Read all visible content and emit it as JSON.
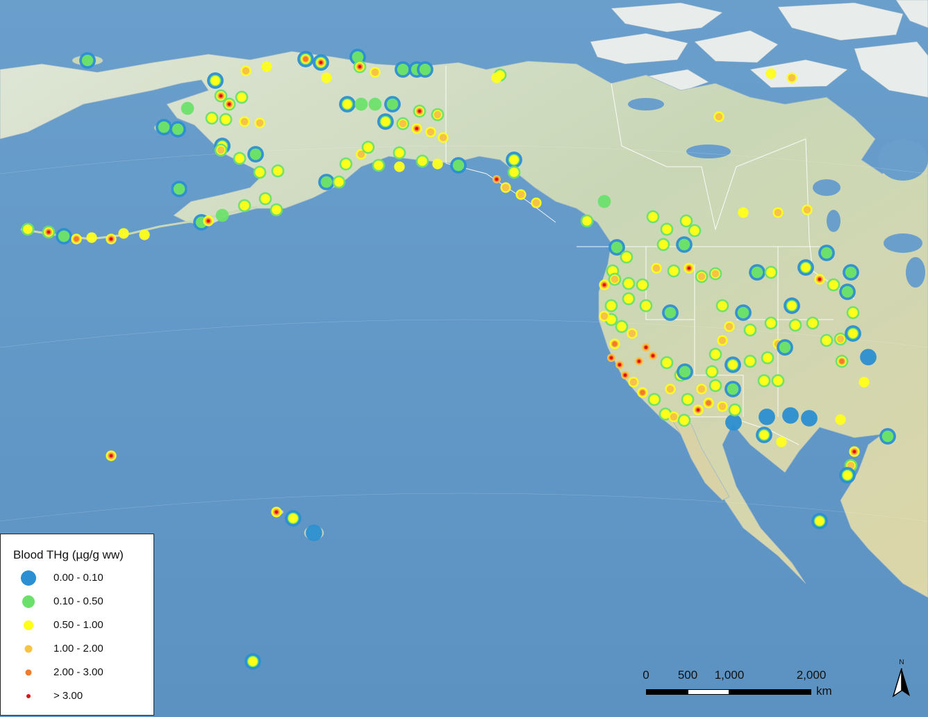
{
  "legend": {
    "title": "Blood THg (µg/g ww)",
    "classes": [
      {
        "label": "0.00 - 0.10",
        "color": "#2b8fd1",
        "glow": ""
      },
      {
        "label": "0.10 - 0.50",
        "color": "#6be06b",
        "glow": ""
      },
      {
        "label": "0.50 - 1.00",
        "color": "#ffff1c",
        "glow": ""
      },
      {
        "label": "1.00 - 2.00",
        "color": "#f7c248",
        "glow": ""
      },
      {
        "label": "2.00 - 3.00",
        "color": "#f47a26",
        "glow": ""
      },
      {
        "label": "> 3.00",
        "color": "#e01010",
        "glow": ""
      }
    ]
  },
  "scale_bar": {
    "ticks": [
      "0",
      "500",
      "1,000",
      "2,000"
    ],
    "unit": "km"
  },
  "north_arrow": {
    "label": "N"
  },
  "colors": {
    "ocean": "#5d95c4",
    "land": "#cdd9bf",
    "arctic_land": "#e7ebea",
    "mexico_land": "#d8d2a6",
    "boundary": "#ffffff"
  },
  "icons": {
    "legend_symbols": "circle",
    "north_arrow": "north-arrow-icon"
  }
}
